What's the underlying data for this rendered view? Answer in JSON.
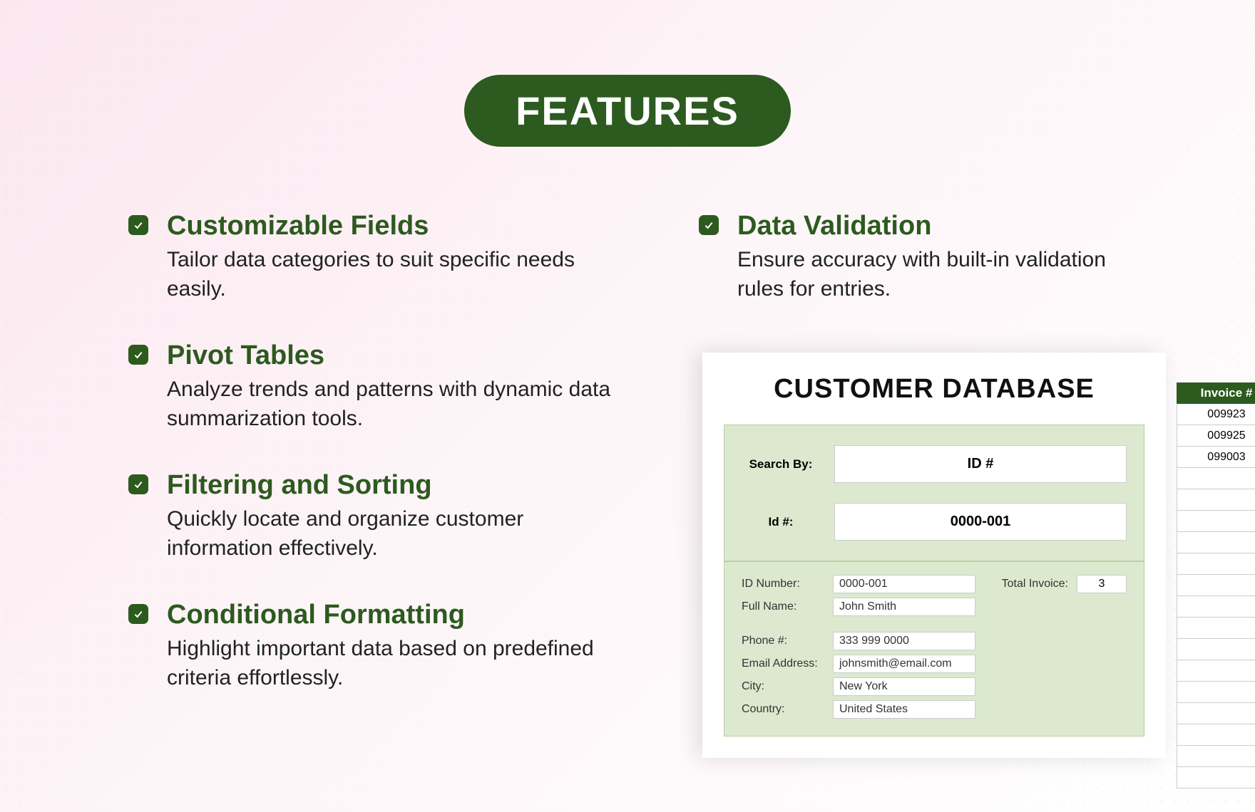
{
  "badge": "FEATURES",
  "features_left": [
    {
      "title": "Customizable Fields",
      "desc": "Tailor data categories to suit specific needs easily."
    },
    {
      "title": "Pivot Tables",
      "desc": "Analyze trends and patterns with dynamic data summarization tools."
    },
    {
      "title": "Filtering and Sorting",
      "desc": "Quickly locate and organize customer information effectively."
    },
    {
      "title": "Conditional Formatting",
      "desc": "Highlight important data based on predefined criteria effortlessly."
    }
  ],
  "features_right": [
    {
      "title": "Data Validation",
      "desc": "Ensure accuracy with built-in validation rules for entries."
    }
  ],
  "card": {
    "title": "CUSTOMER DATABASE",
    "search_by_label": "Search By:",
    "search_by_value": "ID #",
    "id_label": "Id #:",
    "id_value": "0000-001",
    "fields": {
      "id_number_label": "ID Number:",
      "id_number": "0000-001",
      "total_invoice_label": "Total Invoice:",
      "total_invoice": "3",
      "full_name_label": "Full Name:",
      "full_name": "John Smith",
      "phone_label": "Phone #:",
      "phone": "333 999 0000",
      "email_label": "Email Address:",
      "email": "johnsmith@email.com",
      "city_label": "City:",
      "city": "New York",
      "country_label": "Country:",
      "country": "United States"
    }
  },
  "invoice": {
    "header": "Invoice #",
    "rows": [
      "009923",
      "009925",
      "099003",
      "",
      "",
      "",
      "",
      "",
      "",
      "",
      "",
      "",
      "",
      "",
      "",
      "",
      "",
      ""
    ]
  }
}
